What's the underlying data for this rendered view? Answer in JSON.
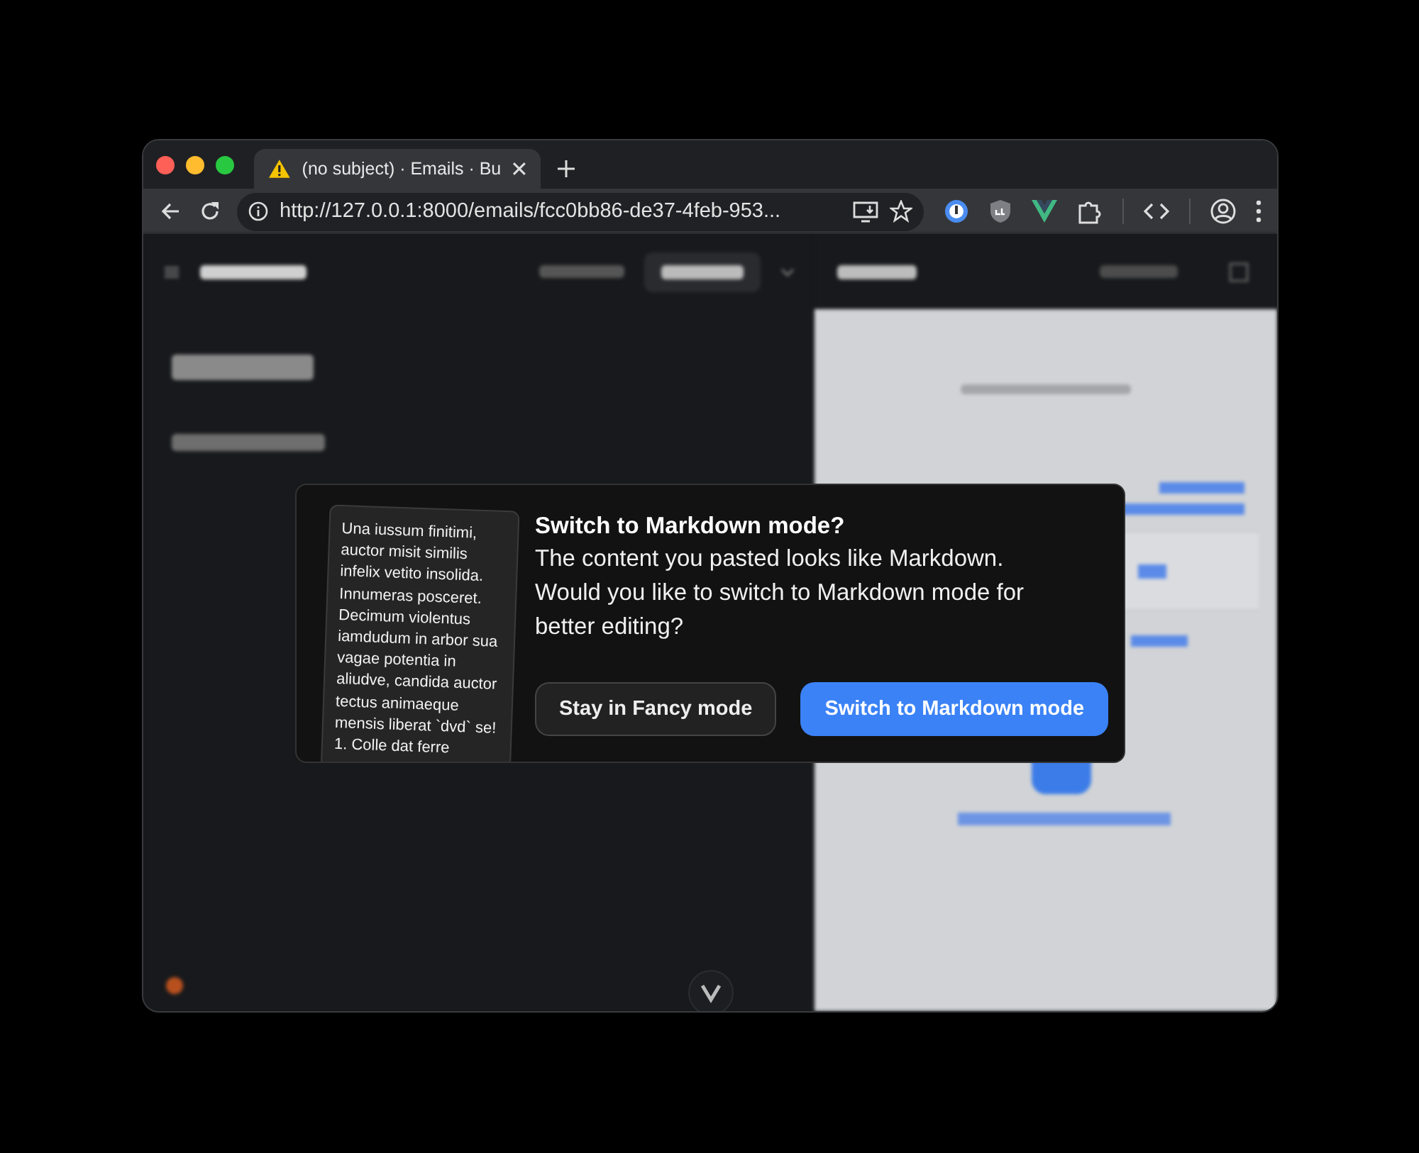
{
  "browser": {
    "tab": {
      "title": "(no subject) · Emails · Bu",
      "selected": true
    },
    "url": "http://127.0.0.1:8000/emails/fcc0bb86-de37-4feb-953..."
  },
  "dialog": {
    "pasted_text": "Una iussum finitimi, auctor misit similis infelix vetito insolida. Innumeras posceret. Decimum violentus iamdudum in arbor sua vagae potentia in aliudve, candida auctor tectus animaeque mensis liberat `dvd` se! 1. Colle dat ferre",
    "title": "Switch to Markdown mode?",
    "message": "The content you pasted looks like Markdown. Would you like to switch to Markdown mode for better editing?",
    "buttons": [
      {
        "label": "Stay in Fancy mode",
        "kind": "secondary"
      },
      {
        "label": "Switch to Markdown mode",
        "kind": "primary"
      }
    ]
  }
}
